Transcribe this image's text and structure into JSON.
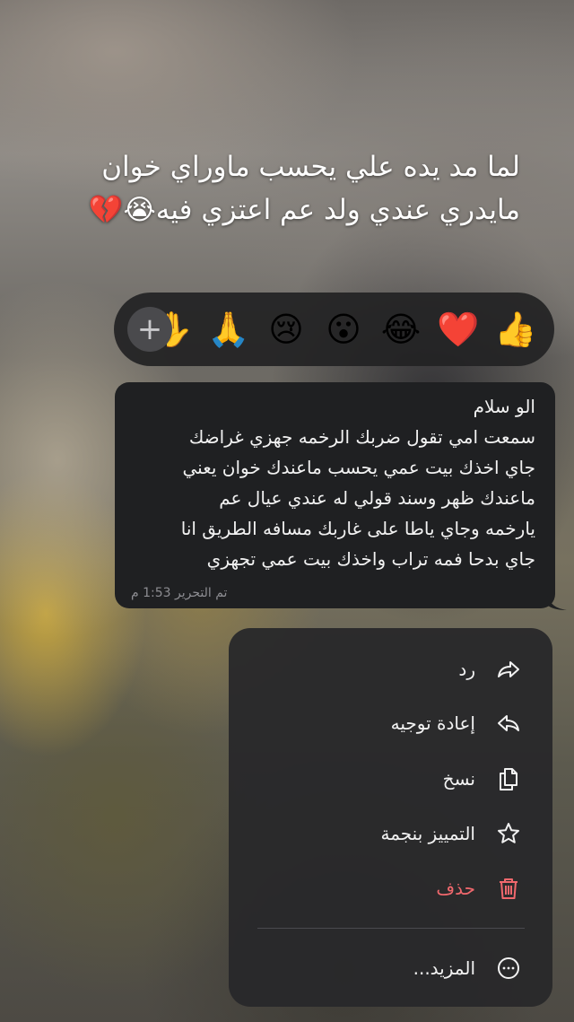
{
  "caption": {
    "line1": "لما مد يده علي يحسب ماوراي خوان",
    "line2": "مايدري عندي ولد عم اعتزي فيه😭💔"
  },
  "reactions": {
    "add_label": "+",
    "items": [
      {
        "name": "raised-hand",
        "glyph": "✋"
      },
      {
        "name": "folded-hands",
        "glyph": "🙏"
      },
      {
        "name": "crying-face",
        "glyph": "😢"
      },
      {
        "name": "surprised-face",
        "glyph": "😮"
      },
      {
        "name": "tears-of-joy",
        "glyph": "😂"
      },
      {
        "name": "red-heart",
        "glyph": "❤️"
      },
      {
        "name": "thumbs-up",
        "glyph": "👍"
      }
    ]
  },
  "message": {
    "lines": [
      "الو سلام",
      "سمعت امي تقول ضربك الرخمه جهزي غراضك",
      "جاي اخذك بيت عمي يحسب ماعندك خوان يعني",
      "ماعندك ظهر وسند قولي له عندي عيال عم",
      "يارخمه وجاي ياطا على غاربك مسافه الطريق انا",
      "جاي بدحا فمه تراب واخذك بيت عمي تجهزي"
    ],
    "edited_label": "تم التحرير 1:53 م"
  },
  "menu": {
    "items": [
      {
        "label": "رد",
        "icon": "reply-icon"
      },
      {
        "label": "إعادة توجيه",
        "icon": "forward-icon"
      },
      {
        "label": "نسخ",
        "icon": "copy-icon"
      },
      {
        "label": "التمييز بنجمة",
        "icon": "star-icon"
      },
      {
        "label": "حذف",
        "icon": "trash-icon"
      },
      {
        "label": "المزيد...",
        "icon": "more-icon"
      }
    ],
    "danger_color": "#f0686d"
  }
}
